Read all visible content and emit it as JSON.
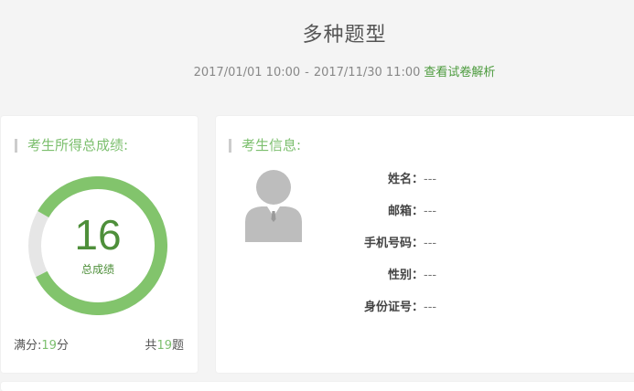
{
  "page": {
    "title": "多种题型",
    "start_time": "2017/01/01 10:00",
    "separator": "-",
    "end_time": "2017/11/30 11:00",
    "analysis_link": "查看试卷解析"
  },
  "score_card": {
    "title": "考生所得总成绩:",
    "score": "16",
    "score_caption": "总成绩",
    "full_score_label": "满分:",
    "full_score_value": "19",
    "full_score_unit": "分",
    "total_prefix": "共",
    "total_value": "19",
    "total_suffix": "题",
    "ring_fraction": 0.842,
    "colors": {
      "ring_fill": "#82c46c",
      "ring_track": "#e6e6e6",
      "score_text": "#4e8f3a",
      "accent": "#7cbf6e"
    }
  },
  "info_card": {
    "title": "考生信息:",
    "avatar_icon": "user-avatar-icon",
    "fields": [
      {
        "label": "姓名：",
        "value": "---"
      },
      {
        "label": "邮箱：",
        "value": "---"
      },
      {
        "label": "手机号码：",
        "value": "---"
      },
      {
        "label": "性别：",
        "value": "---"
      },
      {
        "label": "身份证号：",
        "value": "---"
      }
    ]
  }
}
